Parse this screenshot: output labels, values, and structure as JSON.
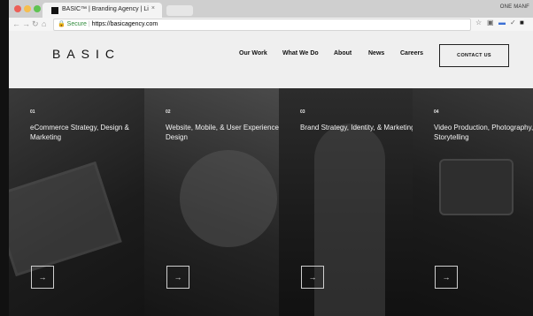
{
  "browser": {
    "tab_title": "BASIC™ | Branding Agency | Li",
    "tab_close": "×",
    "profile_label": "ONE MANF",
    "secure_label": "Secure",
    "url": "https://basicagency.com"
  },
  "site": {
    "logo": "BASIC",
    "nav": [
      "Our Work",
      "What We Do",
      "About",
      "News",
      "Careers"
    ],
    "contact_label": "CONTACT US"
  },
  "panels": [
    {
      "num": "01",
      "title": "eCommerce Strategy, Design & Marketing",
      "arrow": "→"
    },
    {
      "num": "02",
      "title": "Website, Mobile, & User Experience Design",
      "arrow": "→"
    },
    {
      "num": "03",
      "title": "Brand Strategy, Identity, & Marketing",
      "arrow": "→"
    },
    {
      "num": "04",
      "title": "Video Production, Photography, & Storytelling",
      "arrow": "→"
    }
  ],
  "colors": {
    "header_bg": "#efefef",
    "panel_text": "#f4f4f4",
    "secure_green": "#2e8b3a"
  }
}
